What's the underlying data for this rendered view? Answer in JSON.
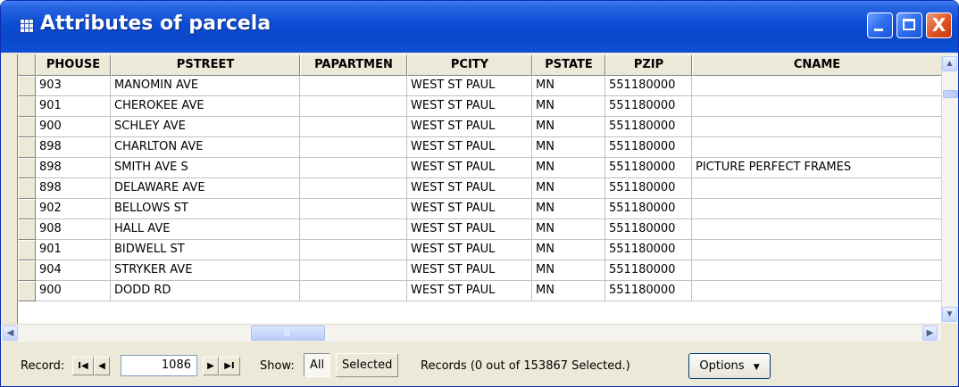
{
  "window": {
    "title": "Attributes of parcela",
    "close_glyph": "X"
  },
  "columns": [
    "PHOUSE",
    "PSTREET",
    "PAPARTMEN",
    "PCITY",
    "PSTATE",
    "PZIP",
    "CNAME"
  ],
  "rows": [
    [
      "903",
      "MANOMIN AVE",
      "",
      "WEST ST PAUL",
      "MN",
      "551180000",
      ""
    ],
    [
      "901",
      "CHEROKEE AVE",
      "",
      "WEST ST PAUL",
      "MN",
      "551180000",
      ""
    ],
    [
      "900",
      "SCHLEY AVE",
      "",
      "WEST ST PAUL",
      "MN",
      "551180000",
      ""
    ],
    [
      "898",
      "CHARLTON AVE",
      "",
      "WEST ST PAUL",
      "MN",
      "551180000",
      ""
    ],
    [
      "898",
      "SMITH AVE S",
      "",
      "WEST ST PAUL",
      "MN",
      "551180000",
      "PICTURE PERFECT FRAMES"
    ],
    [
      "898",
      "DELAWARE AVE",
      "",
      "WEST ST PAUL",
      "MN",
      "551180000",
      ""
    ],
    [
      "902",
      "BELLOWS ST",
      "",
      "WEST ST PAUL",
      "MN",
      "551180000",
      ""
    ],
    [
      "908",
      "HALL AVE",
      "",
      "WEST ST PAUL",
      "MN",
      "551180000",
      ""
    ],
    [
      "901",
      "BIDWELL ST",
      "",
      "WEST ST PAUL",
      "MN",
      "551180000",
      ""
    ],
    [
      "904",
      "STRYKER AVE",
      "",
      "WEST ST PAUL",
      "MN",
      "551180000",
      ""
    ],
    [
      "900",
      "DODD RD",
      "",
      "WEST ST PAUL",
      "MN",
      "551180000",
      ""
    ]
  ],
  "scroll": {
    "up_arrow": "▲",
    "down_arrow": "▼",
    "left_arrow": "◀",
    "right_arrow": "▶"
  },
  "status": {
    "record_label": "Record:",
    "first_glyph": "I◀",
    "prev_glyph": "◀",
    "record_value": "1086",
    "next_glyph": "▶",
    "last_glyph": "▶I",
    "show_label": "Show:",
    "all_label": "All",
    "selected_label": "Selected",
    "records_text": "Records (0 out of 153867 Selected.)",
    "options_label": "Options",
    "options_arrow": "▼"
  },
  "colors": {
    "titlebar": "#0a46c8",
    "grid_face": "#ece9d8",
    "close_button": "#e0521f"
  }
}
